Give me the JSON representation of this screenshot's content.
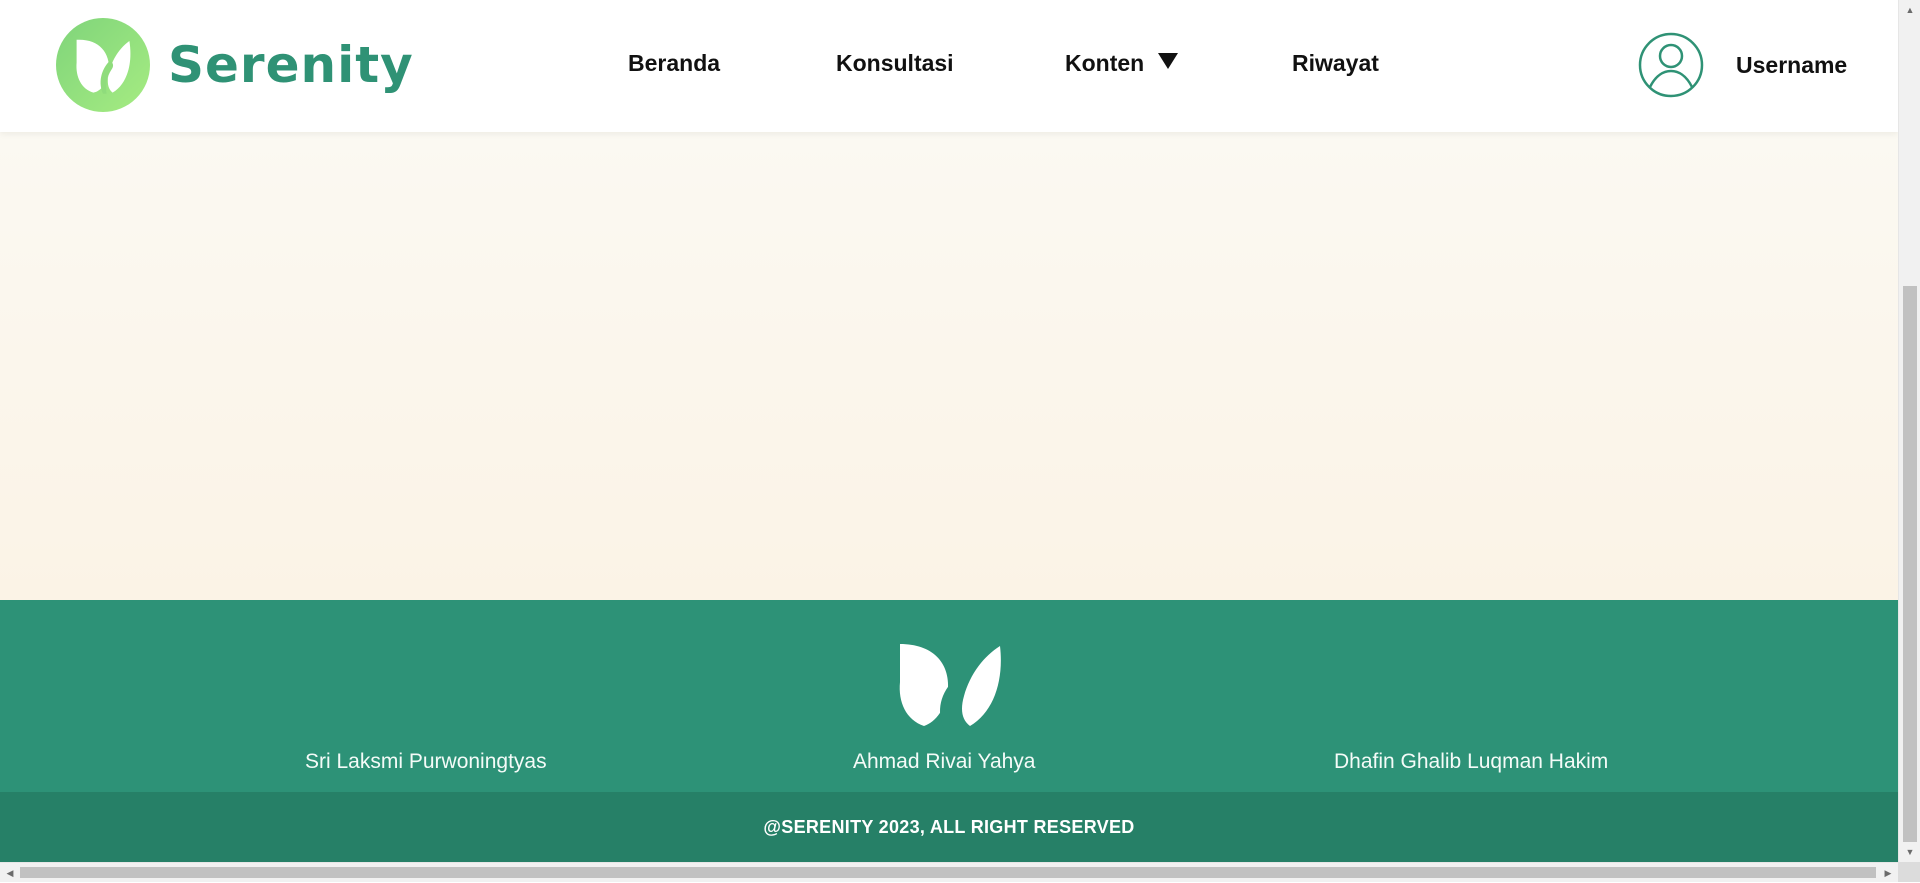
{
  "brand": {
    "name": "Serenity",
    "primary_color": "#2f9275",
    "logo_icon": "leaf-icon"
  },
  "nav": {
    "items": [
      {
        "label": "Beranda"
      },
      {
        "label": "Konsultasi"
      },
      {
        "label": "Konten",
        "has_dropdown": true
      },
      {
        "label": "Riwayat"
      }
    ]
  },
  "user": {
    "name": "Username",
    "avatar_icon": "user-circle-icon"
  },
  "main": {
    "background": "#fbf6ec"
  },
  "footer": {
    "background": "#2d9277",
    "logo_icon": "leaf-icon",
    "names": [
      "Sri Laksmi Purwoningtyas",
      "Ahmad Rivai Yahya",
      "Dhafin Ghalib Luqman Hakim"
    ],
    "copyright": "@SERENITY 2023, ALL RIGHT RESERVED",
    "copyright_background": "#268067"
  }
}
